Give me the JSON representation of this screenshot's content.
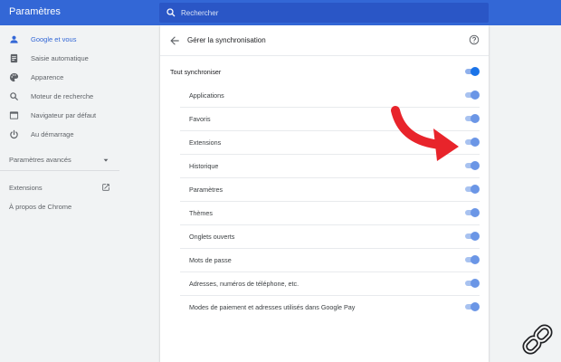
{
  "header": {
    "title": "Paramètres",
    "search_placeholder": "Rechercher"
  },
  "sidebar": {
    "items": [
      {
        "label": "Google et vous",
        "icon": "person-icon"
      },
      {
        "label": "Saisie automatique",
        "icon": "autofill-icon"
      },
      {
        "label": "Apparence",
        "icon": "palette-icon"
      },
      {
        "label": "Moteur de recherche",
        "icon": "search-icon"
      },
      {
        "label": "Navigateur par défaut",
        "icon": "browser-icon"
      },
      {
        "label": "Au démarrage",
        "icon": "power-icon"
      }
    ],
    "advanced_label": "Paramètres avancés",
    "extensions_label": "Extensions",
    "about_label": "À propos de Chrome"
  },
  "sync": {
    "title": "Gérer la synchronisation",
    "sync_all_label": "Tout synchroniser",
    "sync_all_on": true,
    "items": [
      {
        "label": "Applications",
        "on": true
      },
      {
        "label": "Favoris",
        "on": true
      },
      {
        "label": "Extensions",
        "on": true
      },
      {
        "label": "Historique",
        "on": true
      },
      {
        "label": "Paramètres",
        "on": true
      },
      {
        "label": "Thèmes",
        "on": true
      },
      {
        "label": "Onglets ouverts",
        "on": true
      },
      {
        "label": "Mots de passe",
        "on": true
      },
      {
        "label": "Adresses, numéros de téléphone, etc.",
        "on": true
      },
      {
        "label": "Modes de paiement et adresses utilisés dans Google Pay",
        "on": true
      }
    ]
  },
  "colors": {
    "header": "#3367d6",
    "accent": "#1a73e8",
    "arrow": "#e8242b"
  }
}
